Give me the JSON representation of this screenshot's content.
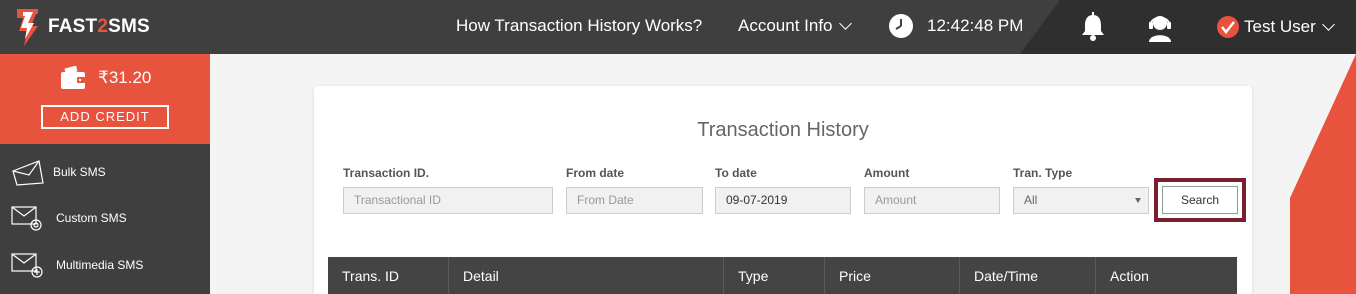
{
  "header": {
    "brand_left": "FAST",
    "brand_mid": "2",
    "brand_right": "SMS",
    "nav_how": "How Transaction History Works?",
    "nav_account": "Account Info",
    "time": "12:42:48 PM",
    "user_name": "Test User",
    "icons": [
      "lightning-logo-icon",
      "clock-icon",
      "bell-icon",
      "support-headset-icon",
      "verified-check-icon"
    ]
  },
  "sidebar": {
    "balance": "₹31.20",
    "add_credit": "ADD CREDIT",
    "items": [
      {
        "label": "Bulk SMS",
        "icon": "envelope-icon"
      },
      {
        "label": "Custom SMS",
        "icon": "envelope-gear-icon"
      },
      {
        "label": "Multimedia SMS",
        "icon": "envelope-plus-icon"
      }
    ]
  },
  "page": {
    "title": "Transaction History",
    "filters": {
      "trans_id": {
        "label": "Transaction ID.",
        "placeholder": "Transactional ID",
        "value": ""
      },
      "from_date": {
        "label": "From date",
        "placeholder": "From Date",
        "value": ""
      },
      "to_date": {
        "label": "To date",
        "value": "09-07-2019"
      },
      "amount": {
        "label": "Amount",
        "placeholder": "Amount",
        "value": ""
      },
      "tran_type": {
        "label": "Tran. Type",
        "value": "All"
      }
    },
    "search_button": "Search",
    "table_headers": [
      "Trans. ID",
      "Detail",
      "Type",
      "Price",
      "Date/Time",
      "Action"
    ]
  },
  "colors": {
    "accent": "#e8533e",
    "dark": "#3f3f3f",
    "highlight": "#7a1f2d"
  }
}
